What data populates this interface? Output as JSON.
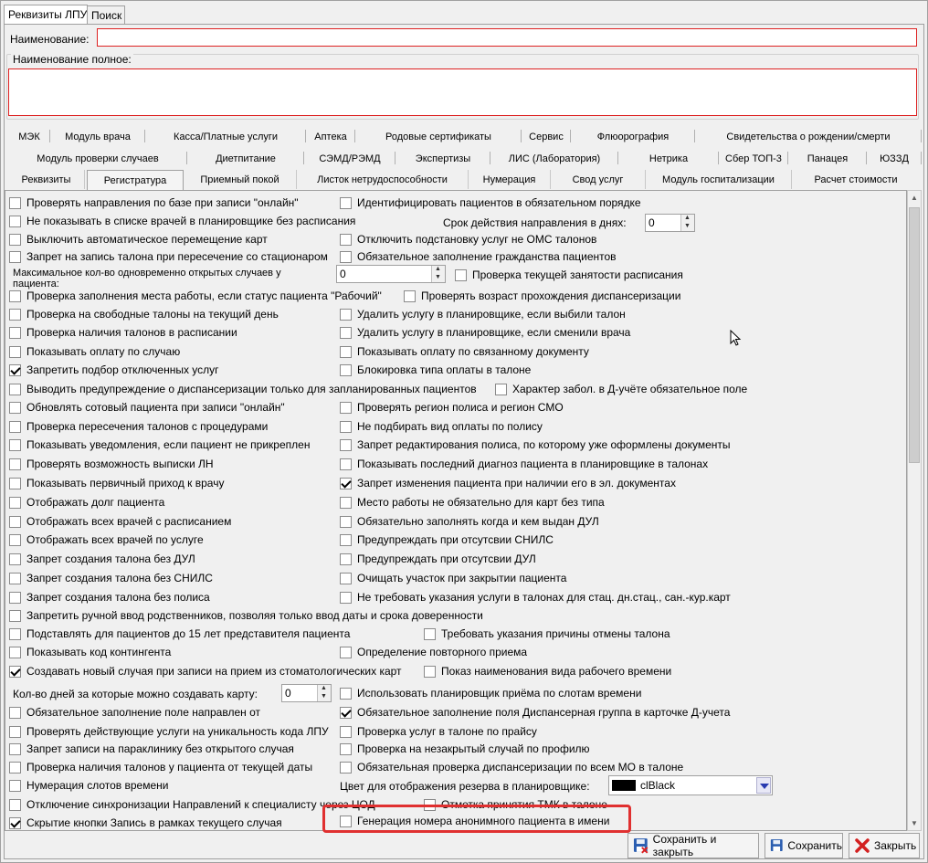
{
  "top_tabs": [
    "Реквизиты ЛПУ",
    "Поиск"
  ],
  "name_label": "Наименование:",
  "name_value": "",
  "full_name_label": "Наименование полное:",
  "full_name_value": "",
  "tabs_row1": [
    "МЭК",
    "Модуль врача",
    "Касса/Платные услуги",
    "Аптека",
    "Родовые сертификаты",
    "Сервис",
    "Флюорография",
    "Свидетельства о рождении/смерти"
  ],
  "tabs_row2": [
    "Модуль проверки случаев",
    "Диетпитание",
    "СЭМД/РЭМД",
    "Экспертизы",
    "ЛИС (Лаборатория)",
    "Нетрика",
    "Сбер ТОП-3",
    "Панацея",
    "ЮЗЗД"
  ],
  "tabs_row3": [
    "Реквизиты",
    "Регистратура",
    "Приемный покой",
    "Листок нетрудоспособности",
    "Нумерация",
    "Свод услуг",
    "Модуль госпитализации",
    "Расчет стоимости"
  ],
  "active_tab": "Регистратура",
  "settings": {
    "c0": {
      "label": "Проверять направления по базе при записи \"онлайн\"",
      "checked": false
    },
    "c1": {
      "label": "Идентифицировать пациентов в обязательном порядке",
      "checked": false
    },
    "c2": {
      "label": "Не показывать в списке врачей в планировщике без расписания",
      "checked": false
    },
    "referral_days_label": "Срок действия направления в днях:",
    "referral_days_value": "0",
    "c3": {
      "label": "Выключить автоматическое перемещение карт",
      "checked": false
    },
    "c4": {
      "label": "Отключить подстановку услуг не ОМС талонов",
      "checked": false
    },
    "c5": {
      "label": "Запрет на запись талона при пересечение со стационаром",
      "checked": false
    },
    "c6": {
      "label": "Обязательное заполнение гражданства пациентов",
      "checked": false
    },
    "max_cases_label_1": "Максимальное кол-во одновременно открытых случаев у",
    "max_cases_label_2": "пациента:",
    "max_cases_value": "0",
    "c7": {
      "label": "Проверка текущей занятости расписания",
      "checked": false
    },
    "c8": {
      "label": "Проверка заполнения места работы, если статус пациента \"Рабочий\"",
      "checked": false
    },
    "c9": {
      "label": "Проверять возраст прохождения диспансеризации",
      "checked": false
    },
    "c10": {
      "label": "Проверка на свободные талоны на текущий день",
      "checked": false
    },
    "c11": {
      "label": "Удалить услугу в планировщике, если выбили талон",
      "checked": false
    },
    "c12": {
      "label": "Проверка наличия талонов в расписании",
      "checked": false
    },
    "c13": {
      "label": "Удалить услугу в планировщике, если сменили врача",
      "checked": false
    },
    "c14": {
      "label": "Показывать оплату по случаю",
      "checked": false
    },
    "c15": {
      "label": "Показывать оплату по связанному документу",
      "checked": false
    },
    "c16": {
      "label": "Запретить подбор отключенных услуг",
      "checked": true
    },
    "c17": {
      "label": "Блокировка типа оплаты в талоне",
      "checked": false
    },
    "c18": {
      "label": "Выводить предупреждение о диспансеризации только для запланированных пациентов",
      "checked": false
    },
    "c19": {
      "label": "Характер забол. в Д-учёте обязательное поле",
      "checked": false
    },
    "c20": {
      "label": "Обновлять сотовый пациента при записи \"онлайн\"",
      "checked": false
    },
    "c21": {
      "label": "Проверять регион полиса и регион СМО",
      "checked": false
    },
    "c22": {
      "label": "Проверка пересечения талонов с процедурами",
      "checked": false
    },
    "c23": {
      "label": "Не подбирать вид оплаты по полису",
      "checked": false
    },
    "c24": {
      "label": "Показывать уведомления, если пациент не прикреплен",
      "checked": false
    },
    "c25": {
      "label": "Запрет редактирования полиса, по которому уже оформлены документы",
      "checked": false
    },
    "c26": {
      "label": "Проверять возможность выписки ЛН",
      "checked": false
    },
    "c27": {
      "label": "Показывать последний диагноз пациента в планировщике в талонах",
      "checked": false
    },
    "c28": {
      "label": "Показывать первичный приход к врачу",
      "checked": false
    },
    "c29": {
      "label": "Запрет изменения пациента при наличии его в эл. документах",
      "checked": true
    },
    "c30": {
      "label": "Отображать долг пациента",
      "checked": false
    },
    "c31": {
      "label": "Место работы не обязательно для карт без типа",
      "checked": false
    },
    "c32": {
      "label": "Отображать всех врачей с расписанием",
      "checked": false
    },
    "c33": {
      "label": "Обязательно заполнять когда и кем выдан ДУЛ",
      "checked": false
    },
    "c34": {
      "label": "Отображать всех врачей по услуге",
      "checked": false
    },
    "c35": {
      "label": "Предупреждать при отсутсвии СНИЛС",
      "checked": false
    },
    "c36": {
      "label": "Запрет создания талона без ДУЛ",
      "checked": false
    },
    "c37": {
      "label": "Предупреждать при отсутсвии ДУЛ",
      "checked": false
    },
    "c38": {
      "label": "Запрет создания талона без СНИЛС",
      "checked": false
    },
    "c39": {
      "label": "Очищать участок при закрытии пациента",
      "checked": false
    },
    "c40": {
      "label": "Запрет создания талона без полиса",
      "checked": false
    },
    "c41": {
      "label": "Не требовать указания услуги в талонах для стац. дн.стац., сан.-кур.карт",
      "checked": false
    },
    "c42": {
      "label": "Запретить ручной ввод родственников, позволяя только ввод даты и срока доверенности",
      "checked": false
    },
    "c43": {
      "label": "Подставлять для пациентов до 15 лет представителя пациента",
      "checked": false
    },
    "c44": {
      "label": "Требовать указания причины отмены талона",
      "checked": false
    },
    "c45": {
      "label": "Показывать код контингента",
      "checked": false
    },
    "c46": {
      "label": "Определение повторного приема",
      "checked": false
    },
    "c47": {
      "label": "Создавать новый случая при записи на прием из стоматологических карт",
      "checked": true
    },
    "c48": {
      "label": "Показ наименования вида рабочего времени",
      "checked": false
    },
    "card_days_label": "Кол-во дней за которые можно создавать карту:",
    "card_days_value": "0",
    "c49": {
      "label": "Использовать планировщик приёма по слотам времени",
      "checked": false
    },
    "c50": {
      "label": "Обязательное заполнение поле направлен от",
      "checked": false
    },
    "c51": {
      "label": "Обязательное заполнение поля Диспансерная группа в карточке Д-учета",
      "checked": true
    },
    "c52": {
      "label": "Проверять действующие услуги на уникальность кода ЛПУ",
      "checked": false
    },
    "c53": {
      "label": "Проверка услуг в талоне по прайсу",
      "checked": false
    },
    "c54": {
      "label": "Запрет записи на параклинику без открытого случая",
      "checked": false
    },
    "c55": {
      "label": "Проверка на незакрытый случай по профилю",
      "checked": false
    },
    "c56": {
      "label": "Проверка наличия талонов у пациента от текущей даты",
      "checked": false
    },
    "c57": {
      "label": "Обязательная проверка диспансеризации по всем МО в талоне",
      "checked": false
    },
    "c58": {
      "label": "Нумерация слотов времени",
      "checked": false
    },
    "reserve_color_label": "Цвет для отображения резерва в планировщике:",
    "reserve_color_value": "clBlack",
    "reserve_color_hex": "#000000",
    "c59": {
      "label": "Отключение синхронизации Направлений к специалисту через ЦОД",
      "checked": false
    },
    "c60": {
      "label": "Отметка принятия ТМК в талоне",
      "checked": false
    },
    "c61": {
      "label": "Скрытие кнопки Запись в рамках текущего случая",
      "checked": true
    },
    "c62": {
      "label": "Генерация номера анонимного пациента в имени",
      "checked": false
    }
  },
  "buttons": {
    "save_close": "Сохранить и закрыть",
    "save": "Сохранить",
    "close": "Закрыть"
  },
  "colors": {
    "highlight": "#e03030",
    "field_border": "#d22222"
  }
}
